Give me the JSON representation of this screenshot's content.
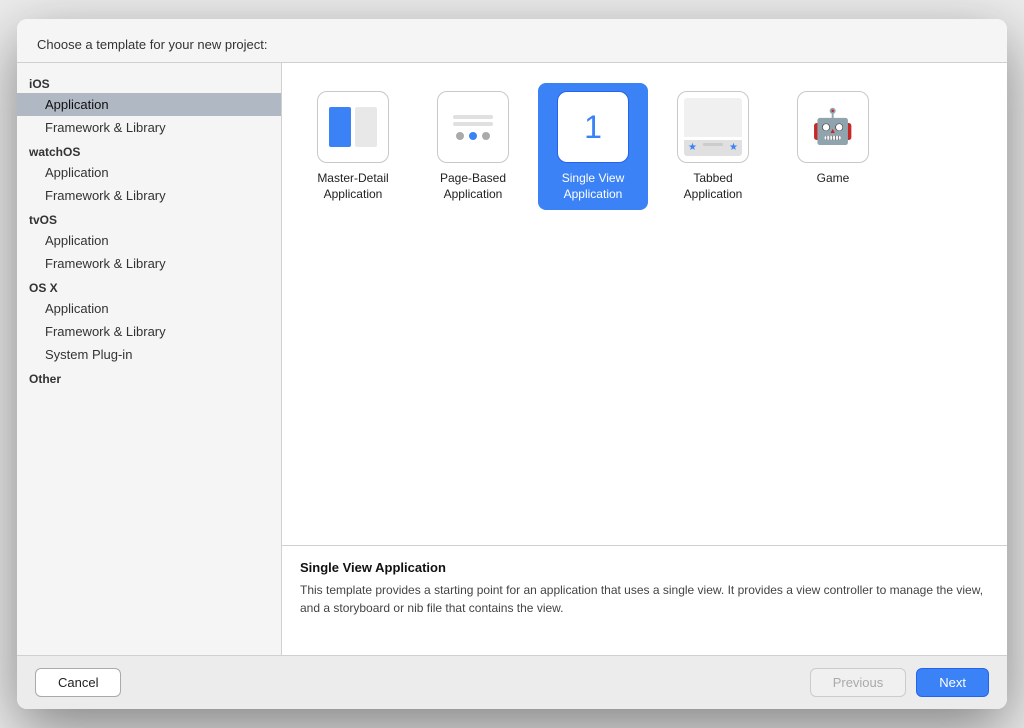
{
  "dialog": {
    "header": "Choose a template for your new project:",
    "sidebar": {
      "categories": [
        {
          "label": "iOS",
          "items": [
            "Application",
            "Framework & Library"
          ]
        },
        {
          "label": "watchOS",
          "items": [
            "Application",
            "Framework & Library"
          ]
        },
        {
          "label": "tvOS",
          "items": [
            "Application",
            "Framework & Library"
          ]
        },
        {
          "label": "OS X",
          "items": [
            "Application",
            "Framework & Library",
            "System Plug-in"
          ]
        },
        {
          "label": "Other",
          "items": []
        }
      ]
    },
    "templates": [
      {
        "id": "master-detail",
        "label": "Master-Detail\nApplication",
        "selected": false
      },
      {
        "id": "page-based",
        "label": "Page-Based\nApplication",
        "selected": false
      },
      {
        "id": "single-view",
        "label": "Single View\nApplication",
        "selected": true
      },
      {
        "id": "tabbed",
        "label": "Tabbed\nApplication",
        "selected": false
      },
      {
        "id": "game",
        "label": "Game",
        "selected": false
      }
    ],
    "description": {
      "title": "Single View Application",
      "text": "This template provides a starting point for an application that uses a single view. It provides a view controller to manage the view, and a storyboard or nib file that contains the view."
    },
    "footer": {
      "cancel_label": "Cancel",
      "previous_label": "Previous",
      "next_label": "Next"
    }
  }
}
